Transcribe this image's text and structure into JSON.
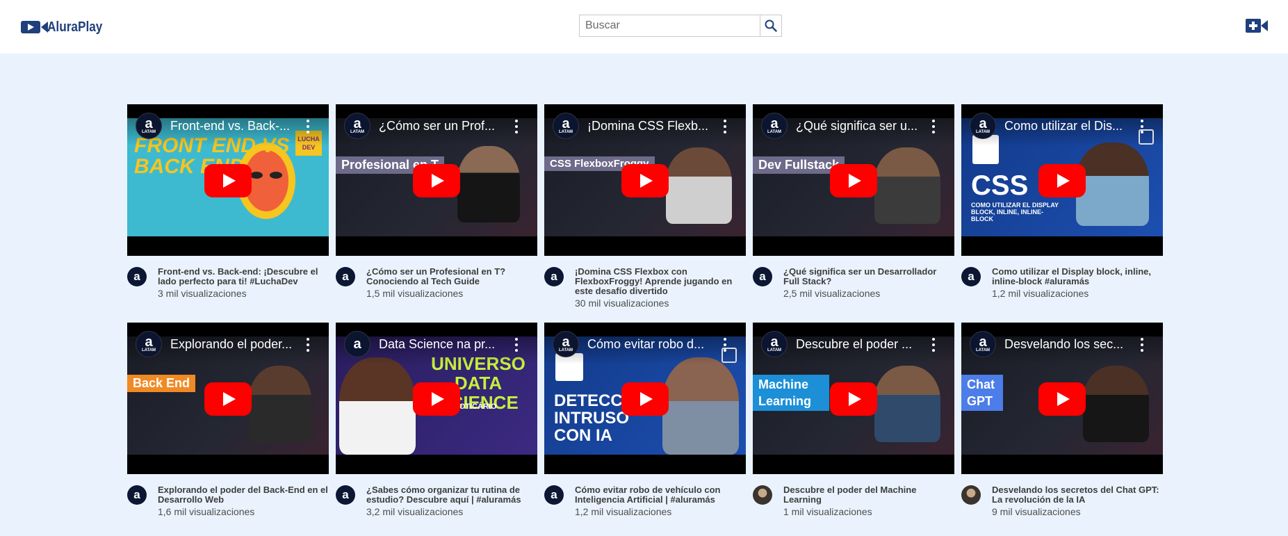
{
  "header": {
    "brand": "AluraPlay",
    "search": {
      "placeholder": "Buscar",
      "value": ""
    },
    "icons": {
      "search": "search-icon",
      "upload": "video-add-icon",
      "logo": "video-camera-icon"
    }
  },
  "colors": {
    "brand": "#1f3f7d",
    "page_bg": "#eaf3fd",
    "play_red": "#ff0000"
  },
  "videos": [
    {
      "thumb_title": "Front-end vs. Back-...",
      "title": "Front-end vs. Back-end: ¡Descubre el lado perfecto para ti! #LuchaDev",
      "views": "3 mil visualizaciones",
      "overlay": "FRONT END VS BACK END",
      "badge": "LUCHA DEV"
    },
    {
      "thumb_title": "¿Cómo ser un Prof...",
      "title": "¿Cómo ser un Profesional en T? Conociendo al Tech Guide",
      "views": "1,5 mil visualizaciones",
      "overlay": "Profesional en T"
    },
    {
      "thumb_title": "¡Domina CSS Flexb...",
      "title": "¡Domina CSS Flexbox con FlexboxFroggy! Aprende jugando en este desafío divertido",
      "views": "30 mil visualizaciones",
      "overlay": "CSS FlexboxFroggy"
    },
    {
      "thumb_title": "¿Qué significa ser u...",
      "title": "¿Qué significa ser un Desarrollador Full Stack?",
      "views": "2,5 mil visualizaciones",
      "overlay": "Dev Fullstack"
    },
    {
      "thumb_title": "Como utilizar el Dis...",
      "title": "Como utilizar el Display block, inline, inline-block #aluramás",
      "views": "1,2 mil visualizaciones",
      "overlay": "CSS",
      "overlay_sub": "COMO UTILIZAR EL DISPLAY BLOCK, INLINE, INLINE-BLOCK"
    },
    {
      "thumb_title": "Explorando el poder...",
      "title": "Explorando el poder del Back-End en el Desarrollo Web",
      "views": "1,6 mil visualizaciones",
      "overlay": "Back End"
    },
    {
      "thumb_title": "Data Science na pr...",
      "title": "¿Sabes cómo organizar tu rutina de estudio? Descubre aquí | #aluramás",
      "views": "3,2 mil visualizaciones",
      "overlay": "UNIVERSO DATA SCIENCE",
      "overlay_sub": "o BOTICÁRIO"
    },
    {
      "thumb_title": "Cómo evitar robo d...",
      "title": "Cómo evitar robo de vehículo con Inteligencia Artificial | #aluramás",
      "views": "1,2 mil visualizaciones",
      "overlay": "DETECC INTRUSO CON IA"
    },
    {
      "thumb_title": "Descubre el poder ...",
      "title": "Descubre el poder del Machine Learning",
      "views": "1 mil visualizaciones",
      "overlay": "Machine Learning"
    },
    {
      "thumb_title": "Desvelando los sec...",
      "title": "Desvelando los secretos del Chat GPT: La revolución de la IA",
      "views": "9 mil visualizaciones",
      "overlay": "Chat GPT"
    }
  ]
}
